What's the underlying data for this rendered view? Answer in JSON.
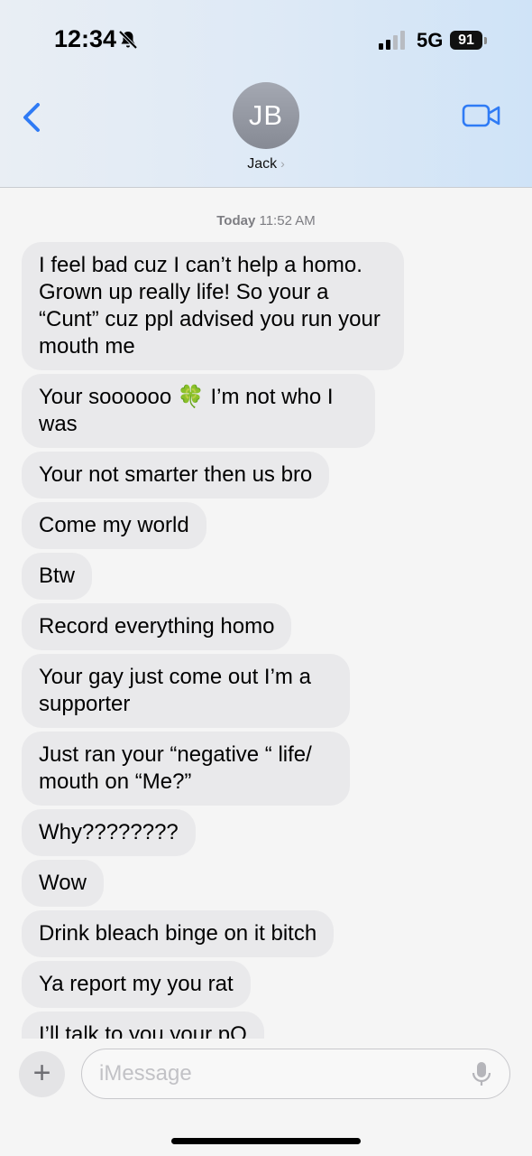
{
  "status_bar": {
    "time": "12:34",
    "network": "5G",
    "battery": "91",
    "icons": [
      "bell-slash-icon",
      "cellular-signal-icon",
      "battery-icon"
    ]
  },
  "header": {
    "avatar_initials": "JB",
    "contact_name": "Jack",
    "chevron": "›",
    "icons": [
      "back-chevron-icon",
      "video-camera-icon"
    ]
  },
  "thread": {
    "timestamp_day": "Today",
    "timestamp_time": "11:52 AM",
    "messages": [
      "I feel bad cuz I can’t help a homo. Grown up really life! So your a “Cunt” cuz ppl advised you run your mouth me",
      "Your soooooo 🍀 I’m not who I was",
      "Your not smarter then us bro",
      "Come my world",
      "Btw",
      "Record everything homo",
      "Your gay just come out I’m a supporter",
      "Just ran your “negative “ life/ mouth on “Me?”",
      "Why????????",
      "Wow",
      "Drink bleach binge on it bitch",
      "Ya report my you rat",
      "I’ll talk to you your pO"
    ],
    "message2_parts": {
      "before": "Your soooooo ",
      "emoji": "🍀",
      "after": " I’m not who I was"
    }
  },
  "composer": {
    "plus_label": "+",
    "placeholder": "iMessage",
    "icons": [
      "plus-icon",
      "microphone-icon"
    ]
  },
  "colors": {
    "accent": "#2f7bf5",
    "bubble_incoming": "#e9e9eb",
    "background": "#f5f5f5"
  }
}
